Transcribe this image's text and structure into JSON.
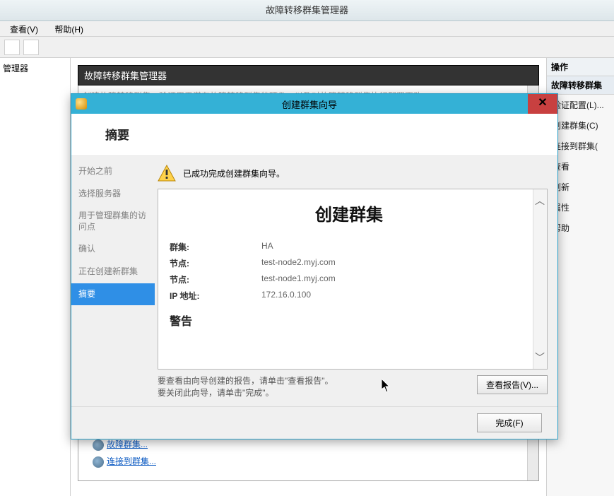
{
  "app": {
    "title": "故障转移群集管理器",
    "menu": {
      "view": "查看(V)",
      "help": "帮助(H)"
    },
    "tree_root": "管理器",
    "center_header": "故障转移群集管理器",
    "center_desc": "创建故障转移群集、验证用于潜在故障转移群集的硬件，以及对故障转移群集执行配置更改。",
    "links": {
      "create": "故障群集...",
      "connect": "连接到群集..."
    }
  },
  "actions": {
    "header": "操作",
    "sub": "故障转移群集",
    "items": [
      "验证配置(L)...",
      "创建群集(C)",
      "连接到群集(",
      "查看",
      "刷新",
      "属性",
      "帮助"
    ]
  },
  "wizard": {
    "title": "创建群集向导",
    "close_glyph": "✕",
    "head": "摘要",
    "steps": [
      "开始之前",
      "选择服务器",
      "用于管理群集的访问点",
      "确认",
      "正在创建新群集",
      "摘要"
    ],
    "active_step_index": 5,
    "success_message": "已成功完成创建群集向导。",
    "report": {
      "title": "创建群集",
      "rows": [
        {
          "label": "群集:",
          "value": "HA"
        },
        {
          "label": "节点:",
          "value": "test-node2.myj.com"
        },
        {
          "label": "节点:",
          "value": "test-node1.myj.com"
        },
        {
          "label": "IP 地址:",
          "value": "172.16.0.100"
        }
      ],
      "warning_heading": "警告"
    },
    "hint_line1": "要查看由向导创建的报告，请单击\"查看报告\"。",
    "hint_line2": "要关闭此向导，请单击\"完成\"。",
    "view_report_btn": "查看报告(V)...",
    "finish_btn": "完成(F)"
  }
}
